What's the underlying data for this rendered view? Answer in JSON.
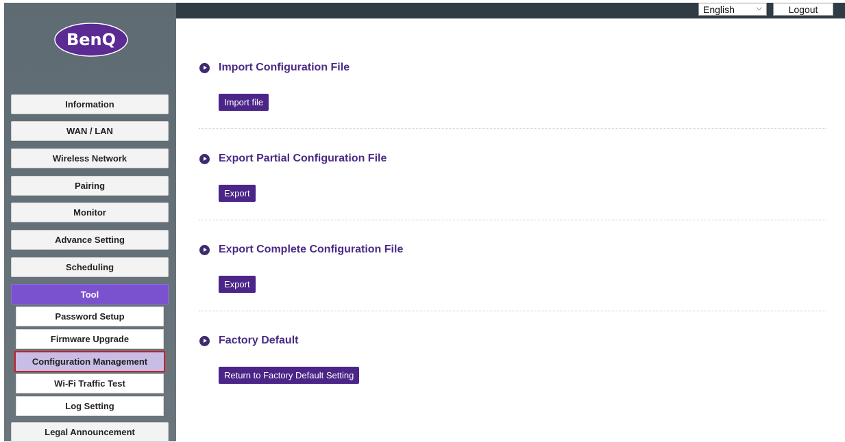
{
  "brand": {
    "logo_text": "BenQ",
    "logo_color": "#5b2a93"
  },
  "topbar": {
    "language": "English",
    "logout_label": "Logout"
  },
  "sidebar": {
    "items": [
      {
        "label": "Information"
      },
      {
        "label": "WAN / LAN"
      },
      {
        "label": "Wireless Network"
      },
      {
        "label": "Pairing"
      },
      {
        "label": "Monitor"
      },
      {
        "label": "Advance Setting"
      },
      {
        "label": "Scheduling"
      },
      {
        "label": "Tool",
        "active": true
      },
      {
        "label": "Legal Announcement"
      }
    ],
    "tool_subitems": [
      {
        "label": "Password Setup"
      },
      {
        "label": "Firmware Upgrade"
      },
      {
        "label": "Configuration Management",
        "selected": true
      },
      {
        "label": "Wi-Fi Traffic Test"
      },
      {
        "label": "Log Setting"
      }
    ]
  },
  "sections": [
    {
      "title": "Import Configuration File",
      "button": "Import file"
    },
    {
      "title": "Export Partial Configuration File",
      "button": "Export"
    },
    {
      "title": "Export Complete Configuration File",
      "button": "Export"
    },
    {
      "title": "Factory Default",
      "button": "Return to Factory Default Setting"
    }
  ],
  "colors": {
    "accent": "#7a52cf",
    "button": "#4b2587",
    "title": "#4a2a86",
    "topbar": "#2f3b45",
    "sidebar": "#5f6b73",
    "selected_border": "#c8202a"
  }
}
